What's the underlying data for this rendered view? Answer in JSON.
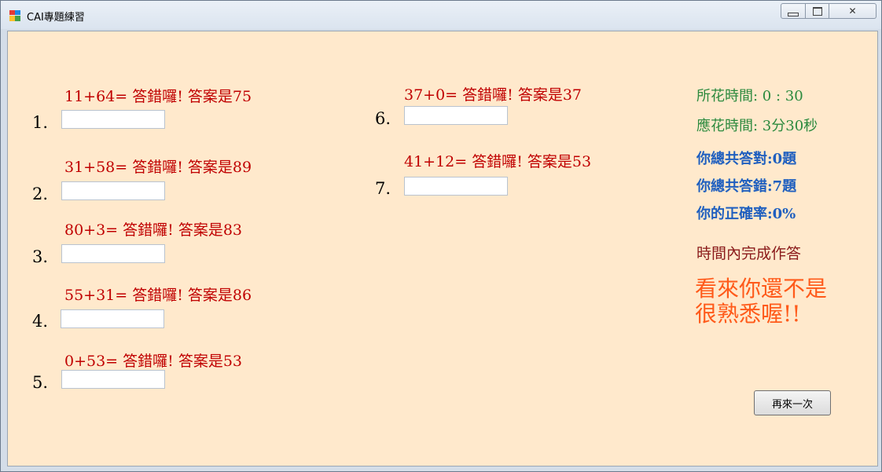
{
  "window": {
    "title": "CAI專題練習",
    "colors": {
      "client_bg": "#ffe9cc",
      "wrong": "#c00000",
      "time": "#2b8a3e",
      "stats": "#1f5fbf",
      "message": "#ff5a1a"
    }
  },
  "questions": [
    {
      "number": "1.",
      "prompt": "11+64= 答錯囉! 答案是75",
      "value": ""
    },
    {
      "number": "2.",
      "prompt": "31+58= 答錯囉! 答案是89",
      "value": ""
    },
    {
      "number": "3.",
      "prompt": "80+3= 答錯囉! 答案是83",
      "value": ""
    },
    {
      "number": "4.",
      "prompt": "55+31= 答錯囉! 答案是86",
      "value": ""
    },
    {
      "number": "5.",
      "prompt": "0+53= 答錯囉! 答案是53",
      "value": ""
    },
    {
      "number": "6.",
      "prompt": "37+0= 答錯囉! 答案是37",
      "value": ""
    },
    {
      "number": "7.",
      "prompt": "41+12= 答錯囉! 答案是53",
      "value": ""
    }
  ],
  "info": {
    "time_spent": "所花時間:   0    : 30",
    "time_allowed": "應花時間:    3分30秒",
    "correct": "你總共答對:0題",
    "wrong": "你總共答錯:7題",
    "accuracy": "你的正確率:0%",
    "status": "時間內完成作答",
    "message_line1": "看來你還不是",
    "message_line2": "很熟悉喔!!"
  },
  "buttons": {
    "again": "再來一次"
  }
}
